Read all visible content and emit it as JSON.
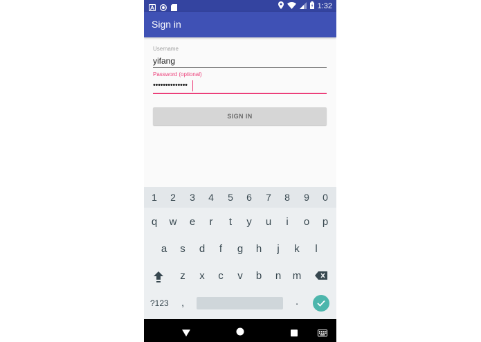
{
  "status_bar": {
    "time": "1:32",
    "left_icons": [
      "notification-a-icon",
      "notification-circle-icon",
      "sim-card-icon"
    ],
    "right_icons": [
      "location-icon",
      "wifi-icon",
      "signal-icon",
      "battery-icon"
    ]
  },
  "app_bar": {
    "title": "Sign in"
  },
  "form": {
    "username_label": "Username",
    "username_value": "yifang",
    "password_label": "Password (optional)",
    "password_value": "••••••••••••••",
    "sign_in_label": "SIGN IN"
  },
  "keyboard": {
    "numbers": [
      "1",
      "2",
      "3",
      "4",
      "5",
      "6",
      "7",
      "8",
      "9",
      "0"
    ],
    "row1": [
      "q",
      "w",
      "e",
      "r",
      "t",
      "y",
      "u",
      "i",
      "o",
      "p"
    ],
    "row2": [
      "a",
      "s",
      "d",
      "f",
      "g",
      "h",
      "j",
      "k",
      "l"
    ],
    "row3": [
      "z",
      "x",
      "c",
      "v",
      "b",
      "n",
      "m"
    ],
    "symbols_label": "?123",
    "comma_label": ",",
    "period_label": "."
  },
  "colors": {
    "status_bar": "#3444a0",
    "app_bar": "#3f51b5",
    "accent": "#ec407a",
    "done_key": "#4db6ac"
  }
}
